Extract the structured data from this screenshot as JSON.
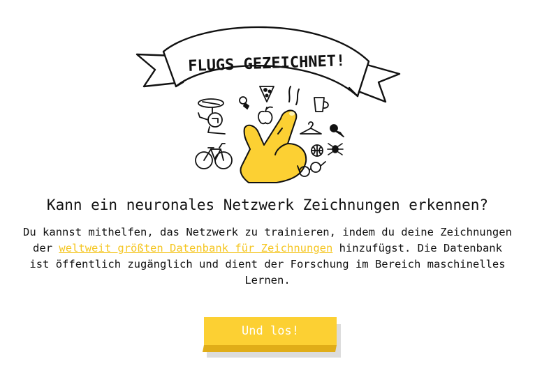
{
  "banner": {
    "title": "FLUGS GEZEICHNET!"
  },
  "headline": "Kann ein neuronales Netzwerk Zeichnungen erkennen?",
  "description": {
    "before_link": "Du kannst mithelfen, das Netzwerk zu trainieren, indem du deine Zeichnungen der ",
    "link_text": "weltweit größten Datenbank für Zeichnungen",
    "after_link": " hinzufügst. Die Datenbank ist öffentlich zugänglich und dient der Forschung im Bereich maschinelles Lernen."
  },
  "cta": {
    "label": "Und los!"
  },
  "colors": {
    "accent": "#fcd033",
    "accent_dark": "#e0ad18",
    "link": "#f5c622",
    "text": "#111111",
    "button_text": "#ffffff"
  },
  "icons": [
    "banner-ribbon-icon",
    "pointing-hand-icon",
    "helicopter-icon",
    "lightbulb-icon",
    "pizza-slice-icon",
    "apple-icon",
    "coffee-mug-icon",
    "hanger-icon",
    "ice-cream-cone-icon",
    "basketball-icon",
    "spider-icon",
    "bicycle-icon",
    "eyeglasses-icon"
  ]
}
